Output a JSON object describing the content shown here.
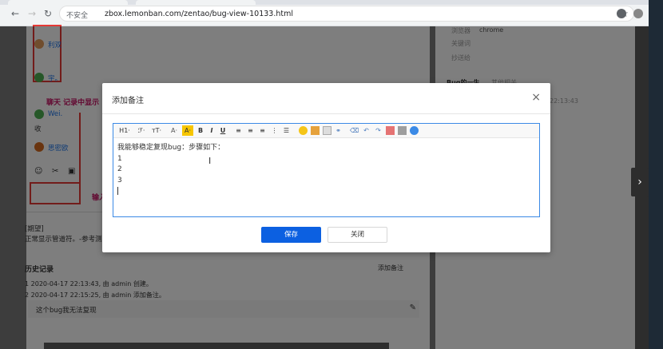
{
  "browser": {
    "insecure_label": "不安全",
    "url": "zbox.lemonban.com/zentao/bug-view-10133.html"
  },
  "chat": {
    "names": [
      "利双",
      "宇。",
      "Wei.",
      "思密欧"
    ],
    "message_text": "收",
    "callout_1": "聊天 记录中显示",
    "callout_2": "输入"
  },
  "right_info": {
    "labels": [
      {
        "key": "浏览器",
        "value": "chrome"
      },
      {
        "key": "关键词",
        "value": ""
      },
      {
        "key": "抄送给",
        "value": ""
      }
    ],
    "section": "Bug的一生",
    "section_extra": "其他相关",
    "timestamp": "22:13:43"
  },
  "bug": {
    "expect_label": "[期望]",
    "expect_text": "正常显示管道符。-参考测",
    "history_title": "历史记录",
    "add_note_link": "添加备注",
    "history": [
      "1  2020-04-17 22:13:43, 由 admin 创建。",
      "2  2020-04-17 22:15:25, 由 admin 添加备注。"
    ],
    "note": "这个bug我无法复现"
  },
  "modal": {
    "title": "添加备注",
    "close_icon": "×",
    "toolbar": {
      "heading": "H1·",
      "font": "ℱ·",
      "size": "тT·",
      "font_color": "A·",
      "bg_color": "A·",
      "bold": "B",
      "italic": "I",
      "underline": "U"
    },
    "content_lines": [
      "我能够稳定复现bug：步骤如下：",
      "1",
      "2",
      "3"
    ],
    "save_label": "保存",
    "close_label": "关闭"
  },
  "colors": {
    "primary": "#0c60e1",
    "editor_border": "#3b8ae6",
    "annotation_red": "#e53935"
  }
}
